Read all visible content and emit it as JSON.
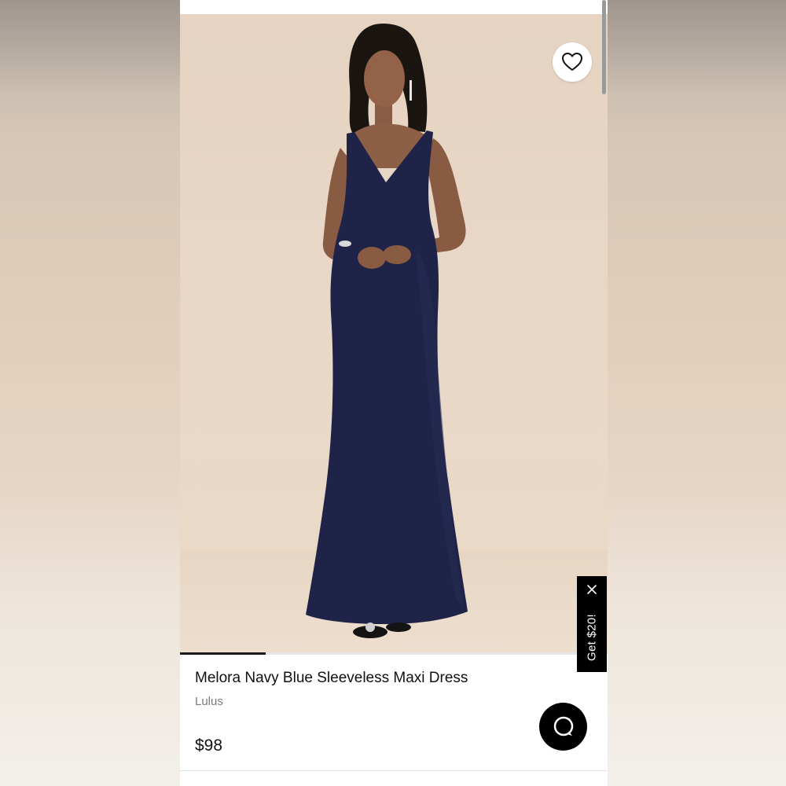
{
  "product": {
    "title": "Melora Navy Blue Sleeveless Maxi Dress",
    "brand": "Lulus",
    "price": "$98"
  },
  "promo": {
    "label": "Get $20!",
    "close_icon": "close-icon"
  },
  "icons": {
    "favorite": "heart-icon",
    "chat": "chat-bubble-icon"
  },
  "carousel": {
    "progress": 0.2
  },
  "colors": {
    "dress": "#1f2347",
    "photo_background": "#e8d6c4",
    "accent": "#000000",
    "brand_text": "#7a7a7a"
  }
}
